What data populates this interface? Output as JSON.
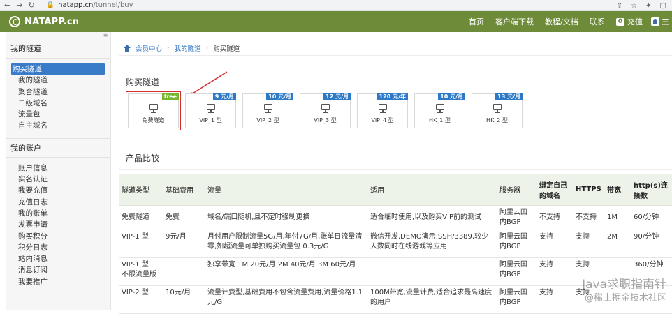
{
  "browser": {
    "url_host": "natapp.cn",
    "url_path": "/tunnel/buy"
  },
  "topnav": {
    "logo": "NATAPP.cn",
    "links": [
      "首页",
      "客户端下载",
      "教程/文档",
      "联系"
    ],
    "balance_amount": "0",
    "recharge": "充值",
    "menu": "三"
  },
  "sidebar": {
    "section1_title": "我的隧道",
    "section1_items": [
      "购买隧道",
      "我的隧道",
      "聚合隧道",
      "二级域名",
      "流量包",
      "自主域名"
    ],
    "section2_title": "我的账户",
    "section2_items": [
      "账户信息",
      "实名认证",
      "我要充值",
      "充值日志",
      "我的账单",
      "发票申请",
      "购买积分",
      "积分日志",
      "站内消息",
      "消息订阅",
      "我要推广"
    ]
  },
  "breadcrumb": {
    "home": "会员中心",
    "parent": "我的隧道",
    "current": "购买隧道"
  },
  "buy": {
    "heading": "购买隧道",
    "cards": [
      {
        "label": "免费隧道",
        "tag": "free"
      },
      {
        "label": "VIP_1 型",
        "tag": "9 元/月"
      },
      {
        "label": "VIP_2 型",
        "tag": "10 元/月"
      },
      {
        "label": "VIP_3 型",
        "tag": "12 元/月"
      },
      {
        "label": "VIP_4 型",
        "tag": "120 元/年"
      },
      {
        "label": "HK_1 型",
        "tag": "10 元/月"
      },
      {
        "label": "HK_2 型",
        "tag": "13 元/月"
      }
    ]
  },
  "compare": {
    "heading": "产品比较",
    "headers": [
      "隧道类型",
      "基础费用",
      "流量",
      "适用",
      "服务器",
      "绑定自己的域名",
      "HTTPS",
      "带宽",
      "http(s)连接数"
    ],
    "rows": [
      [
        "免费隧道",
        "免费",
        "域名/端口随机,且不定时强制更换",
        "适合临时使用,以及购买VIP前的测试",
        "阿里云国内BGP",
        "不支持",
        "不支持",
        "1M",
        "60/分钟"
      ],
      [
        "VIP-1 型",
        "9元/月",
        "月付用户限制流量5G/月,年付7G/月,账单日流量清零,如超流量可单独购买流量包 0.3元/G",
        "微信开发,DEMO演示,SSH/3389,较少人数同时在线游戏等应用",
        "阿里云国内BGP",
        "支持",
        "支持",
        "2M",
        "90/分钟"
      ],
      [
        "VIP-1 型\n不限流量版",
        "",
        "独享带宽 1M 20元/月 2M 40元/月 3M 60元/月",
        "",
        "阿里云国内BGP",
        "支持",
        "支持",
        "",
        "360/分钟"
      ],
      [
        "VIP-2 型",
        "10元/月",
        "流量计费型,基础费用不包含流量费用,流量价格1.1元/G",
        "100M带宽,流量计费,适合追求最高速度的用户",
        "阿里云国内BGP",
        "支持",
        "支持",
        "",
        ""
      ]
    ]
  },
  "watermark": {
    "line1": "Java求职指南针",
    "line2": "@稀土掘金技术社区"
  }
}
